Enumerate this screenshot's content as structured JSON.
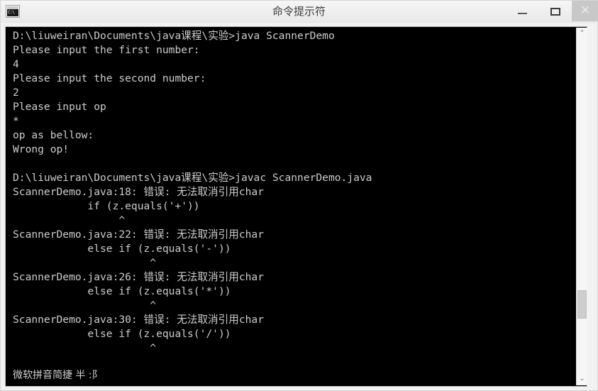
{
  "window": {
    "title": "命令提示符",
    "icon_name": "cmd-console-icon",
    "icon_text": "C:\\",
    "controls": {
      "minimize": "—",
      "maximize": "▢",
      "close": "✕"
    }
  },
  "console": {
    "lines": [
      "D:\\liuweiran\\Documents\\java课程\\实验>java ScannerDemo",
      "Please input the first number:",
      "4",
      "Please input the second number:",
      "2",
      "Please input op",
      "*",
      "op as bellow:",
      "Wrong op!",
      "",
      "D:\\liuweiran\\Documents\\java课程\\实验>javac ScannerDemo.java",
      "ScannerDemo.java:18: 错误: 无法取消引用char",
      "            if (z.equals('+'))",
      "                 ^",
      "ScannerDemo.java:22: 错误: 无法取消引用char",
      "            else if (z.equals('-'))",
      "                      ^",
      "ScannerDemo.java:26: 错误: 无法取消引用char",
      "            else if (z.equals('*'))",
      "                      ^",
      "ScannerDemo.java:30: 错误: 无法取消引用char",
      "            else if (z.equals('/'))",
      "                      ^"
    ],
    "text_color": "#cccccc",
    "background_color": "#000000"
  },
  "ime": {
    "status": "微软拼音简捷 半 :阝"
  },
  "scrollbar": {
    "up_arrow": "⌃",
    "down_arrow": "⌄"
  }
}
